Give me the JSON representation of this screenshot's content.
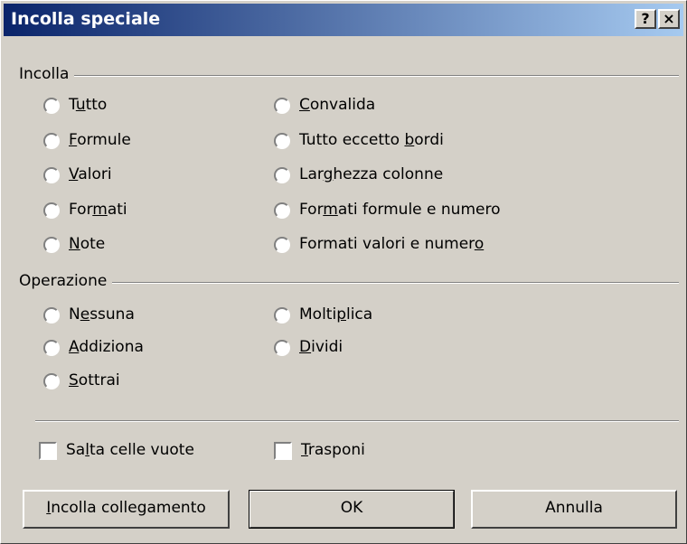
{
  "dialog": {
    "title": "Incolla speciale",
    "help_label": "?",
    "close_label": "×"
  },
  "paste_group": {
    "label": "Incolla",
    "options": [
      {
        "pre": "T",
        "key": "u",
        "post": "tto"
      },
      {
        "pre": "",
        "key": "F",
        "post": "ormule"
      },
      {
        "pre": "",
        "key": "V",
        "post": "alori"
      },
      {
        "pre": "For",
        "key": "m",
        "post": "ati"
      },
      {
        "pre": "",
        "key": "N",
        "post": "ote"
      },
      {
        "pre": "",
        "key": "C",
        "post": "onvalida"
      },
      {
        "pre": "Tutto eccetto ",
        "key": "b",
        "post": "ordi"
      },
      {
        "pre": "Lar",
        "key": "g",
        "post": "hezza colonne"
      },
      {
        "pre": "For",
        "key": "m",
        "post": "ati formule e numero"
      },
      {
        "pre": "Formati valori e numer",
        "key": "o",
        "post": ""
      }
    ]
  },
  "operation_group": {
    "label": "Operazione",
    "options": [
      {
        "pre": "N",
        "key": "e",
        "post": "ssuna"
      },
      {
        "pre": "",
        "key": "A",
        "post": "ddiziona"
      },
      {
        "pre": "",
        "key": "S",
        "post": "ottrai"
      },
      {
        "pre": "Molti",
        "key": "p",
        "post": "lica"
      },
      {
        "pre": "",
        "key": "D",
        "post": "ividi"
      }
    ]
  },
  "checkboxes": {
    "skip_blanks": {
      "pre": "Sa",
      "key": "l",
      "post": "ta celle vuote",
      "checked": false
    },
    "transpose": {
      "pre": "",
      "key": "T",
      "post": "rasponi",
      "checked": false
    }
  },
  "buttons": {
    "paste_link": {
      "pre": "",
      "key": "I",
      "post": "ncolla collegamento"
    },
    "ok": "OK",
    "cancel": "Annulla"
  }
}
